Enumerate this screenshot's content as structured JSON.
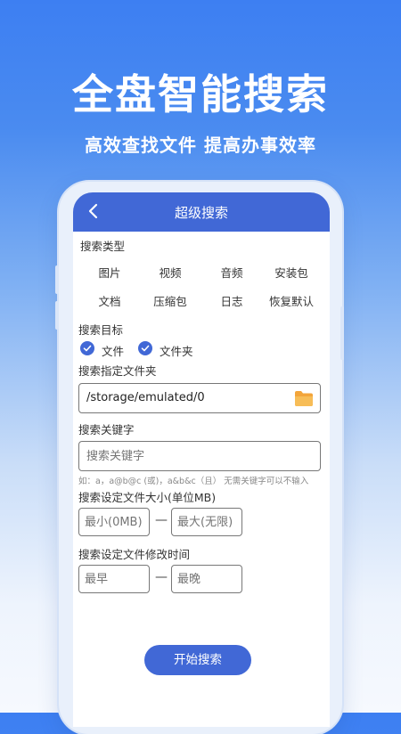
{
  "hero": {
    "title": "全盘智能搜索",
    "subtitle": "高效查找文件 提高办事效率"
  },
  "header": {
    "title": "超级搜索"
  },
  "search_type": {
    "label": "搜索类型",
    "options": [
      "图片",
      "视频",
      "音频",
      "安装包",
      "文档",
      "压缩包",
      "日志",
      "恢复默认"
    ]
  },
  "search_target": {
    "label": "搜索目标",
    "options": [
      {
        "label": "文件",
        "checked": true
      },
      {
        "label": "文件夹",
        "checked": true
      }
    ]
  },
  "folder": {
    "label": "搜索指定文件夹",
    "value": "/storage/emulated/0"
  },
  "keyword": {
    "label": "搜索关键字",
    "placeholder": "搜索关键字",
    "hint": "如：a，a@b@c (或)，a&b&c（且） 无需关键字可以不输入"
  },
  "size": {
    "label": "搜索设定文件大小(单位MB)",
    "min_placeholder": "最小(0MB)",
    "max_placeholder": "最大(无限)",
    "separator": "—"
  },
  "time": {
    "label": "搜索设定文件修改时间",
    "start_placeholder": "最早",
    "end_placeholder": "最晚",
    "separator": "—"
  },
  "actions": {
    "start_label": "开始搜索"
  },
  "colors": {
    "accent": "#4168d6",
    "folder": "#f3a53a",
    "bg_top": "#3d7ff2"
  }
}
